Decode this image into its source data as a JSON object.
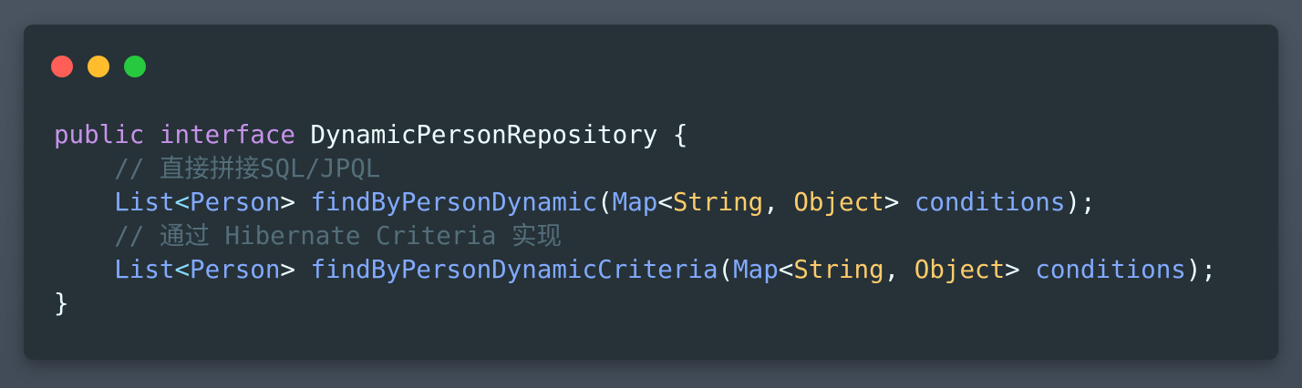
{
  "window": {
    "controls": [
      "close",
      "minimize",
      "maximize"
    ],
    "colors": {
      "background": "#263238",
      "close": "#ff5f56",
      "minimize": "#ffbd2e",
      "maximize": "#27c93f"
    }
  },
  "code": {
    "language": "java",
    "lines": [
      {
        "tokens": [
          {
            "t": "public",
            "k": "kw"
          },
          {
            "t": " ",
            "k": "plain"
          },
          {
            "t": "interface",
            "k": "kw"
          },
          {
            "t": " DynamicPersonRepository {",
            "k": "plain"
          }
        ]
      },
      {
        "tokens": [
          {
            "t": "    // 直接拼接SQL/JPQL",
            "k": "comment"
          }
        ]
      },
      {
        "tokens": [
          {
            "t": "    ",
            "k": "plain"
          },
          {
            "t": "List",
            "k": "type"
          },
          {
            "t": "<",
            "k": "punct"
          },
          {
            "t": "Person",
            "k": "type"
          },
          {
            "t": "> ",
            "k": "plain"
          },
          {
            "t": "findByPersonDynamic",
            "k": "fn"
          },
          {
            "t": "(",
            "k": "plain"
          },
          {
            "t": "Map",
            "k": "type"
          },
          {
            "t": "<",
            "k": "plain"
          },
          {
            "t": "String",
            "k": "cls"
          },
          {
            "t": ", ",
            "k": "plain"
          },
          {
            "t": "Object",
            "k": "cls"
          },
          {
            "t": "> ",
            "k": "plain"
          },
          {
            "t": "conditions",
            "k": "param"
          },
          {
            "t": ");",
            "k": "plain"
          }
        ]
      },
      {
        "tokens": [
          {
            "t": "    // 通过 Hibernate Criteria 实现",
            "k": "comment"
          }
        ]
      },
      {
        "tokens": [
          {
            "t": "    ",
            "k": "plain"
          },
          {
            "t": "List",
            "k": "type"
          },
          {
            "t": "<",
            "k": "punct"
          },
          {
            "t": "Person",
            "k": "type"
          },
          {
            "t": "> ",
            "k": "plain"
          },
          {
            "t": "findByPersonDynamicCriteria",
            "k": "fn"
          },
          {
            "t": "(",
            "k": "plain"
          },
          {
            "t": "Map",
            "k": "type"
          },
          {
            "t": "<",
            "k": "plain"
          },
          {
            "t": "String",
            "k": "cls"
          },
          {
            "t": ", ",
            "k": "plain"
          },
          {
            "t": "Object",
            "k": "cls"
          },
          {
            "t": "> ",
            "k": "plain"
          },
          {
            "t": "conditions",
            "k": "param"
          },
          {
            "t": ");",
            "k": "plain"
          }
        ]
      },
      {
        "tokens": [
          {
            "t": "}",
            "k": "plain"
          }
        ]
      }
    ]
  }
}
